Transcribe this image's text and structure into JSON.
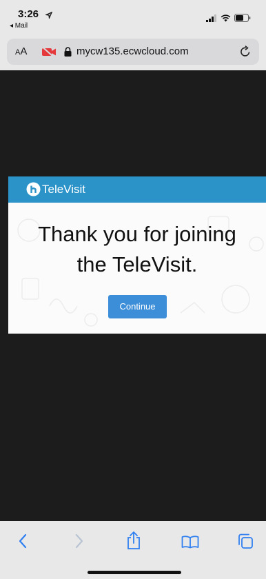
{
  "status_bar": {
    "time": "3:26",
    "back_app": "◂ Mail"
  },
  "browser": {
    "aa_label_small": "A",
    "aa_label_large": "A",
    "url": "mycw135.ecwcloud.com"
  },
  "modal": {
    "brand": "TeleVisit",
    "message_line1": "Thank you for joining",
    "message_line2": "the TeleVisit.",
    "continue_label": "Continue"
  },
  "colors": {
    "header": "#2c93c9",
    "button": "#3c8ed8",
    "toolbar_icon": "#2f7ff0",
    "page_background": "#1c1c1d"
  },
  "icons": [
    "location-arrow-icon",
    "signal-icon",
    "wifi-icon",
    "battery-icon",
    "camera-off-icon",
    "lock-icon",
    "reload-icon",
    "back-icon",
    "forward-icon",
    "share-icon",
    "bookmarks-icon",
    "tabs-icon",
    "televisit-logo-icon"
  ]
}
